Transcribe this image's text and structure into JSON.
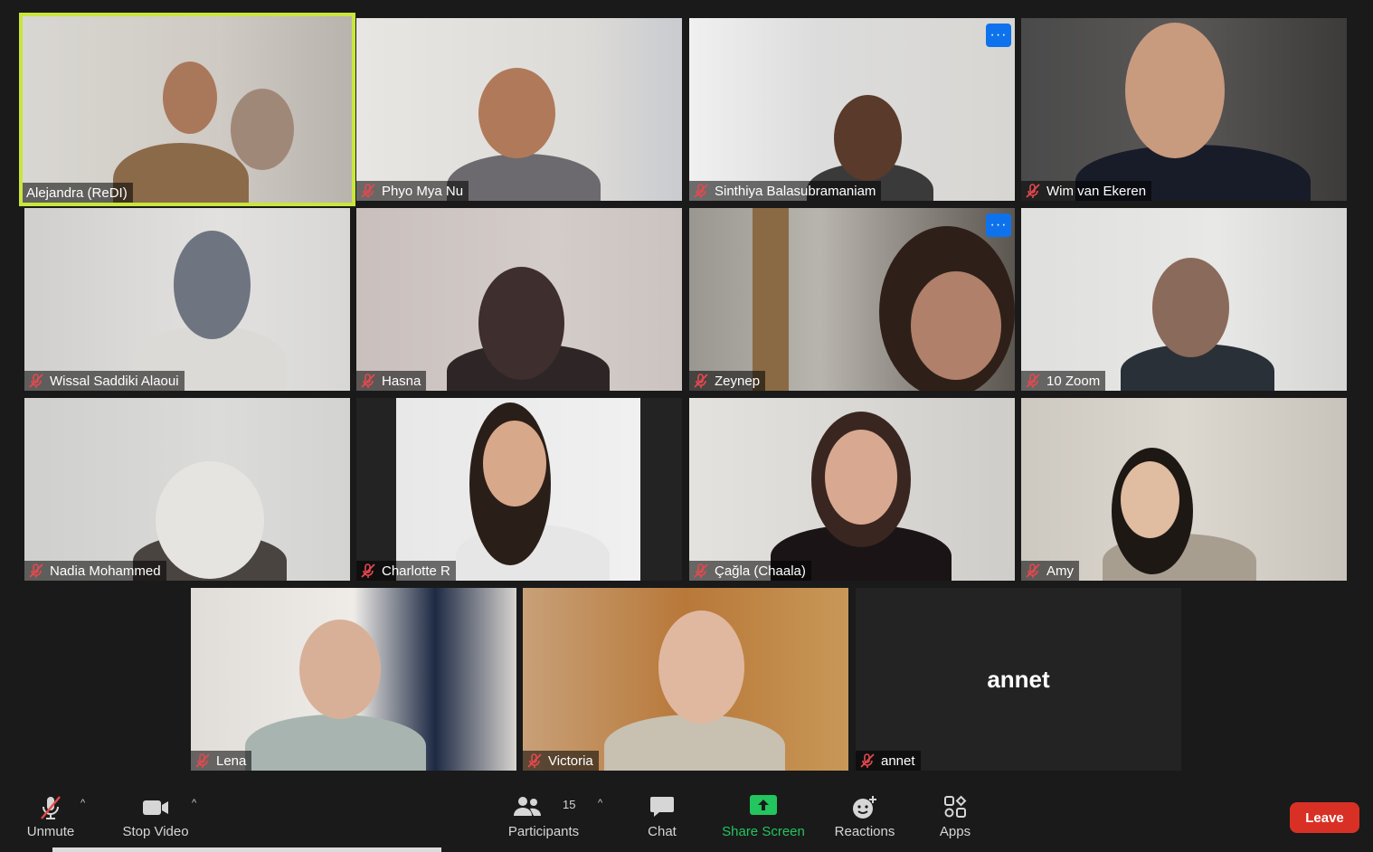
{
  "participants": [
    {
      "name": "Alejandra (ReDI)",
      "muted": false,
      "active_speaker": true
    },
    {
      "name": "Phyo Mya Nu",
      "muted": true
    },
    {
      "name": "Sinthiya Balasubramaniam",
      "muted": true,
      "more_button": "···"
    },
    {
      "name": "Wim van Ekeren",
      "muted": true
    },
    {
      "name": "Wissal Saddiki Alaoui",
      "muted": true
    },
    {
      "name": "Hasna",
      "muted": true
    },
    {
      "name": "Zeynep",
      "muted": true,
      "more_button": "···"
    },
    {
      "name": "10 Zoom",
      "muted": true
    },
    {
      "name": "Nadia Mohammed",
      "muted": true
    },
    {
      "name": "Charlotte R",
      "muted": true
    },
    {
      "name": "Çağla (Chaala)",
      "muted": true
    },
    {
      "name": "Amy",
      "muted": true
    },
    {
      "name": "Lena",
      "muted": true
    },
    {
      "name": "Victoria",
      "muted": true
    },
    {
      "name": "annet",
      "muted": true,
      "video_off_label": "annet"
    }
  ],
  "toolbar": {
    "unmute": "Unmute",
    "stop_video": "Stop Video",
    "participants": "Participants",
    "participants_count": "15",
    "chat": "Chat",
    "share_screen": "Share Screen",
    "reactions": "Reactions",
    "apps": "Apps",
    "leave": "Leave",
    "caret": "^"
  },
  "colors": {
    "active_speaker_border": "#c8e63c",
    "share_screen": "#22c55e",
    "leave": "#d93025",
    "mute_icon": "#e5484d",
    "more_button": "#0e72ed"
  }
}
